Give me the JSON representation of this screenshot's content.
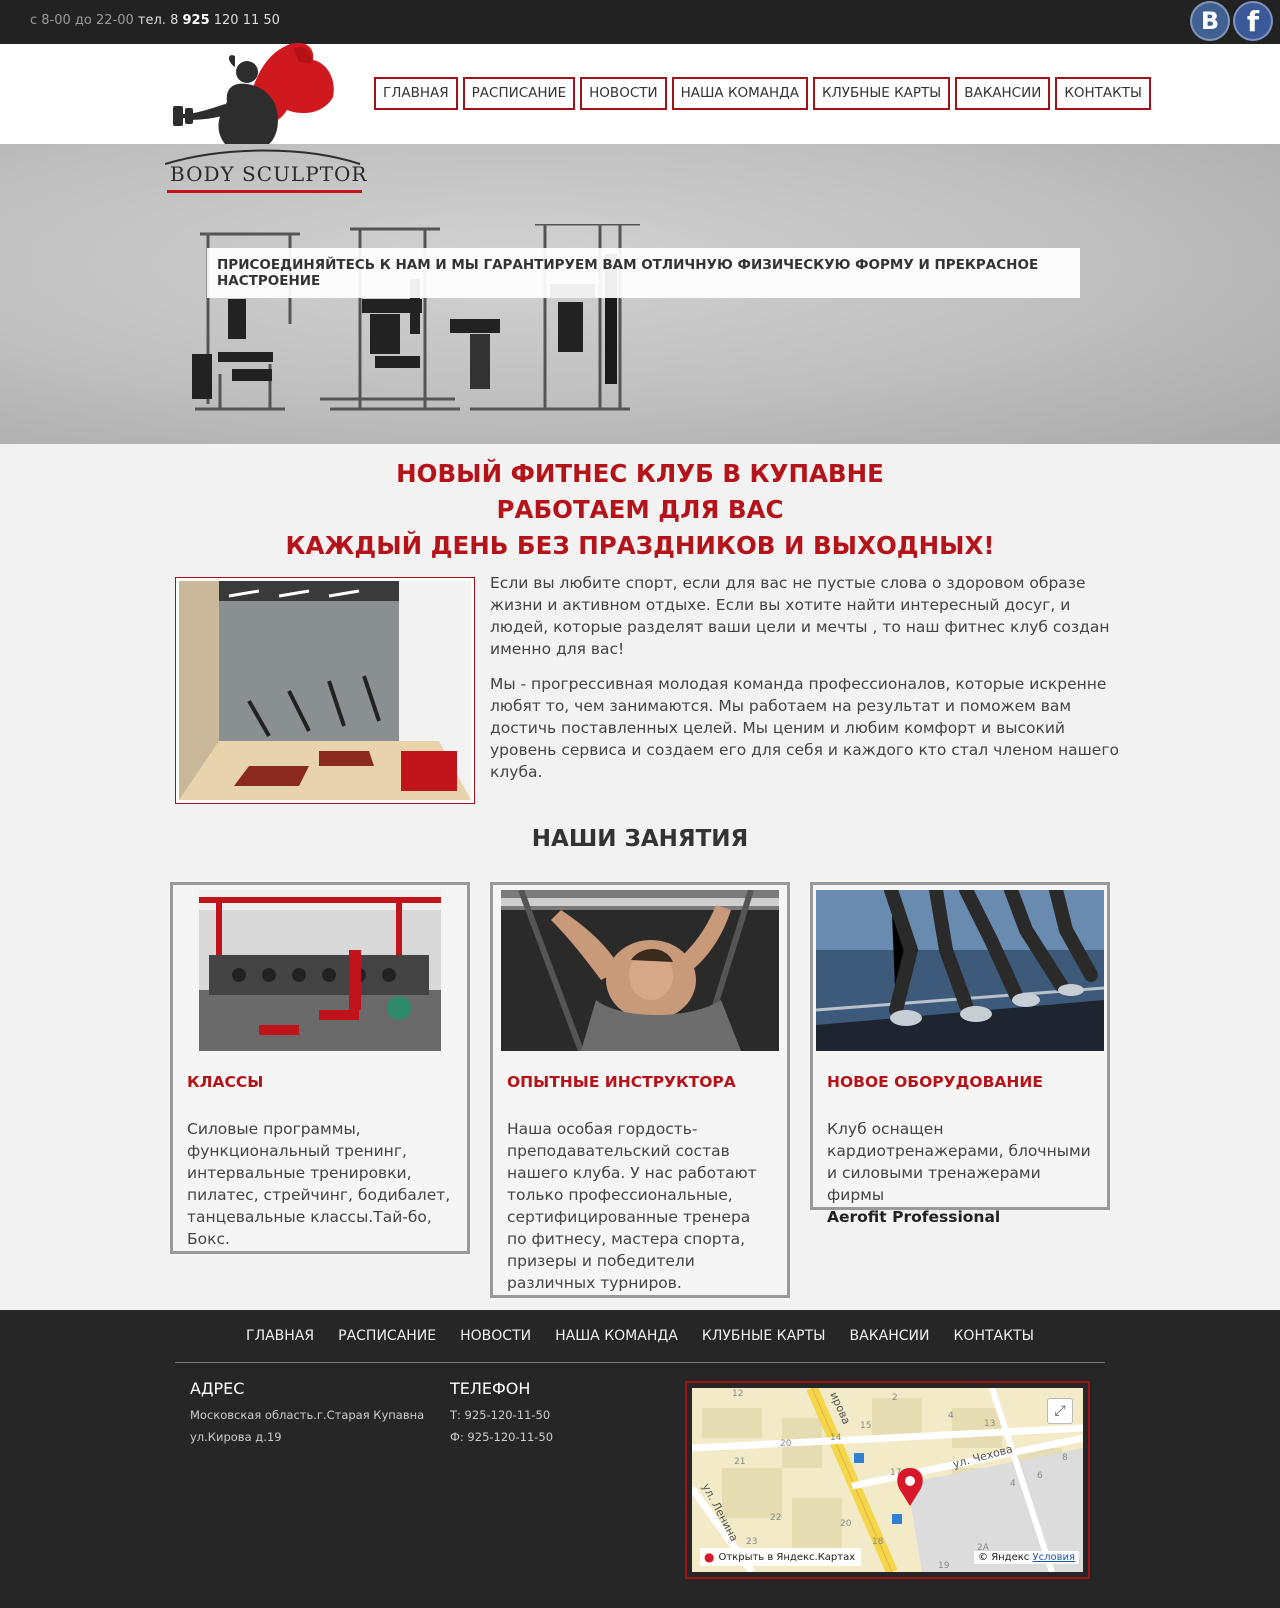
{
  "topbar": {
    "hours": "с 8-00 до 22-00",
    "tel_label": "тел.",
    "tel_prefix": "8",
    "tel_code": "925",
    "tel_rest": "120 11 50",
    "social": {
      "vk": "В",
      "fb": "f"
    }
  },
  "logo": {
    "text": "BODY SCULPTOR"
  },
  "nav": [
    "ГЛАВНАЯ",
    "РАСПИСАНИЕ",
    "НОВОСТИ",
    "НАША КОМАНДА",
    "КЛУБНЫЕ КАРТЫ",
    "ВАКАНСИИ",
    "КОНТАКТЫ"
  ],
  "hero": {
    "banner": "ПРИСОЕДИНЯЙТЕСЬ К НАМ И МЫ ГАРАНТИРУЕМ ВАМ ОТЛИЧНУЮ ФИЗИЧЕСКУЮ ФОРМУ И ПРЕКРАСНОЕ НАСТРОЕНИЕ"
  },
  "headline": [
    "НОВЫЙ ФИТНЕС КЛУБ В КУПАВНЕ",
    "РАБОТАЕМ ДЛЯ ВАС",
    "КАЖДЫЙ ДЕНЬ БЕЗ ПРАЗДНИКОВ И ВЫХОДНЫХ!"
  ],
  "intro": [
    "Если вы любите спорт, если для вас не пустые слова о здоровом образе жизни и активном отдыхе. Если вы хотите найти интересный досуг, и людей, которые разделят ваши цели и мечты , то наш фитнес клуб создан именно для вас!",
    "Мы - прогрессивная молодая команда профессионалов, которые искренне любят то, чем занимаются. Мы работаем на результат и поможем вам достичь поставленных целей. Мы ценим и любим комфорт и высокий уровень сервиса и создаем его для себя и каждого кто стал членом нашего клуба."
  ],
  "section_title": "НАШИ ЗАНЯТИЯ",
  "cards": [
    {
      "title": "КЛАССЫ",
      "body": "Силовые программы, функциональный тренинг, интервальные тренировки, пилатес, стрейчинг, бодибалет, танцевальные классы.Тай-бо, Бокс."
    },
    {
      "title": "ОПЫТНЫЕ ИНСТРУКТОРА",
      "body": "Наша особая гордость- преподавательский состав нашего клуба. У нас работают только профессиональные, сертифицированные тренера по фитнесу, мастера спорта, призеры и победители различных турниров."
    },
    {
      "title": "НОВОЕ ОБОРУДОВАНИЕ",
      "body": "Клуб оснащен кардиотренажерами, блочными и силовыми тренажерами фирмы",
      "brand": "Aerofit Professional"
    }
  ],
  "footer": {
    "nav": [
      "ГЛАВНАЯ",
      "РАСПИСАНИЕ",
      "НОВОСТИ",
      "НАША КОМАНДА",
      "КЛУБНЫЕ КАРТЫ",
      "ВАКАНСИИ",
      "КОНТАКТЫ"
    ],
    "address": {
      "title": "АДРЕС",
      "line1": "Московская область.г.Старая Купавна",
      "line2": "ул.Кирова д.19"
    },
    "phone": {
      "title": "ТЕЛЕФОН",
      "tel": "Т: 925-120-11-50",
      "fax": "Ф: 925-120-11-50"
    },
    "map": {
      "open_link": "Открыть в Яндекс.Картах",
      "copyright": "© Яндекс",
      "terms": "Условия",
      "streets": [
        "ул. Чехова",
        "ул. Ленина",
        "ирова"
      ],
      "house_numbers": [
        "12",
        "2",
        "15",
        "14",
        "20",
        "4",
        "13",
        "21",
        "17",
        "6",
        "8",
        "22",
        "20",
        "18",
        "23",
        "19",
        "2А",
        "4"
      ]
    }
  }
}
